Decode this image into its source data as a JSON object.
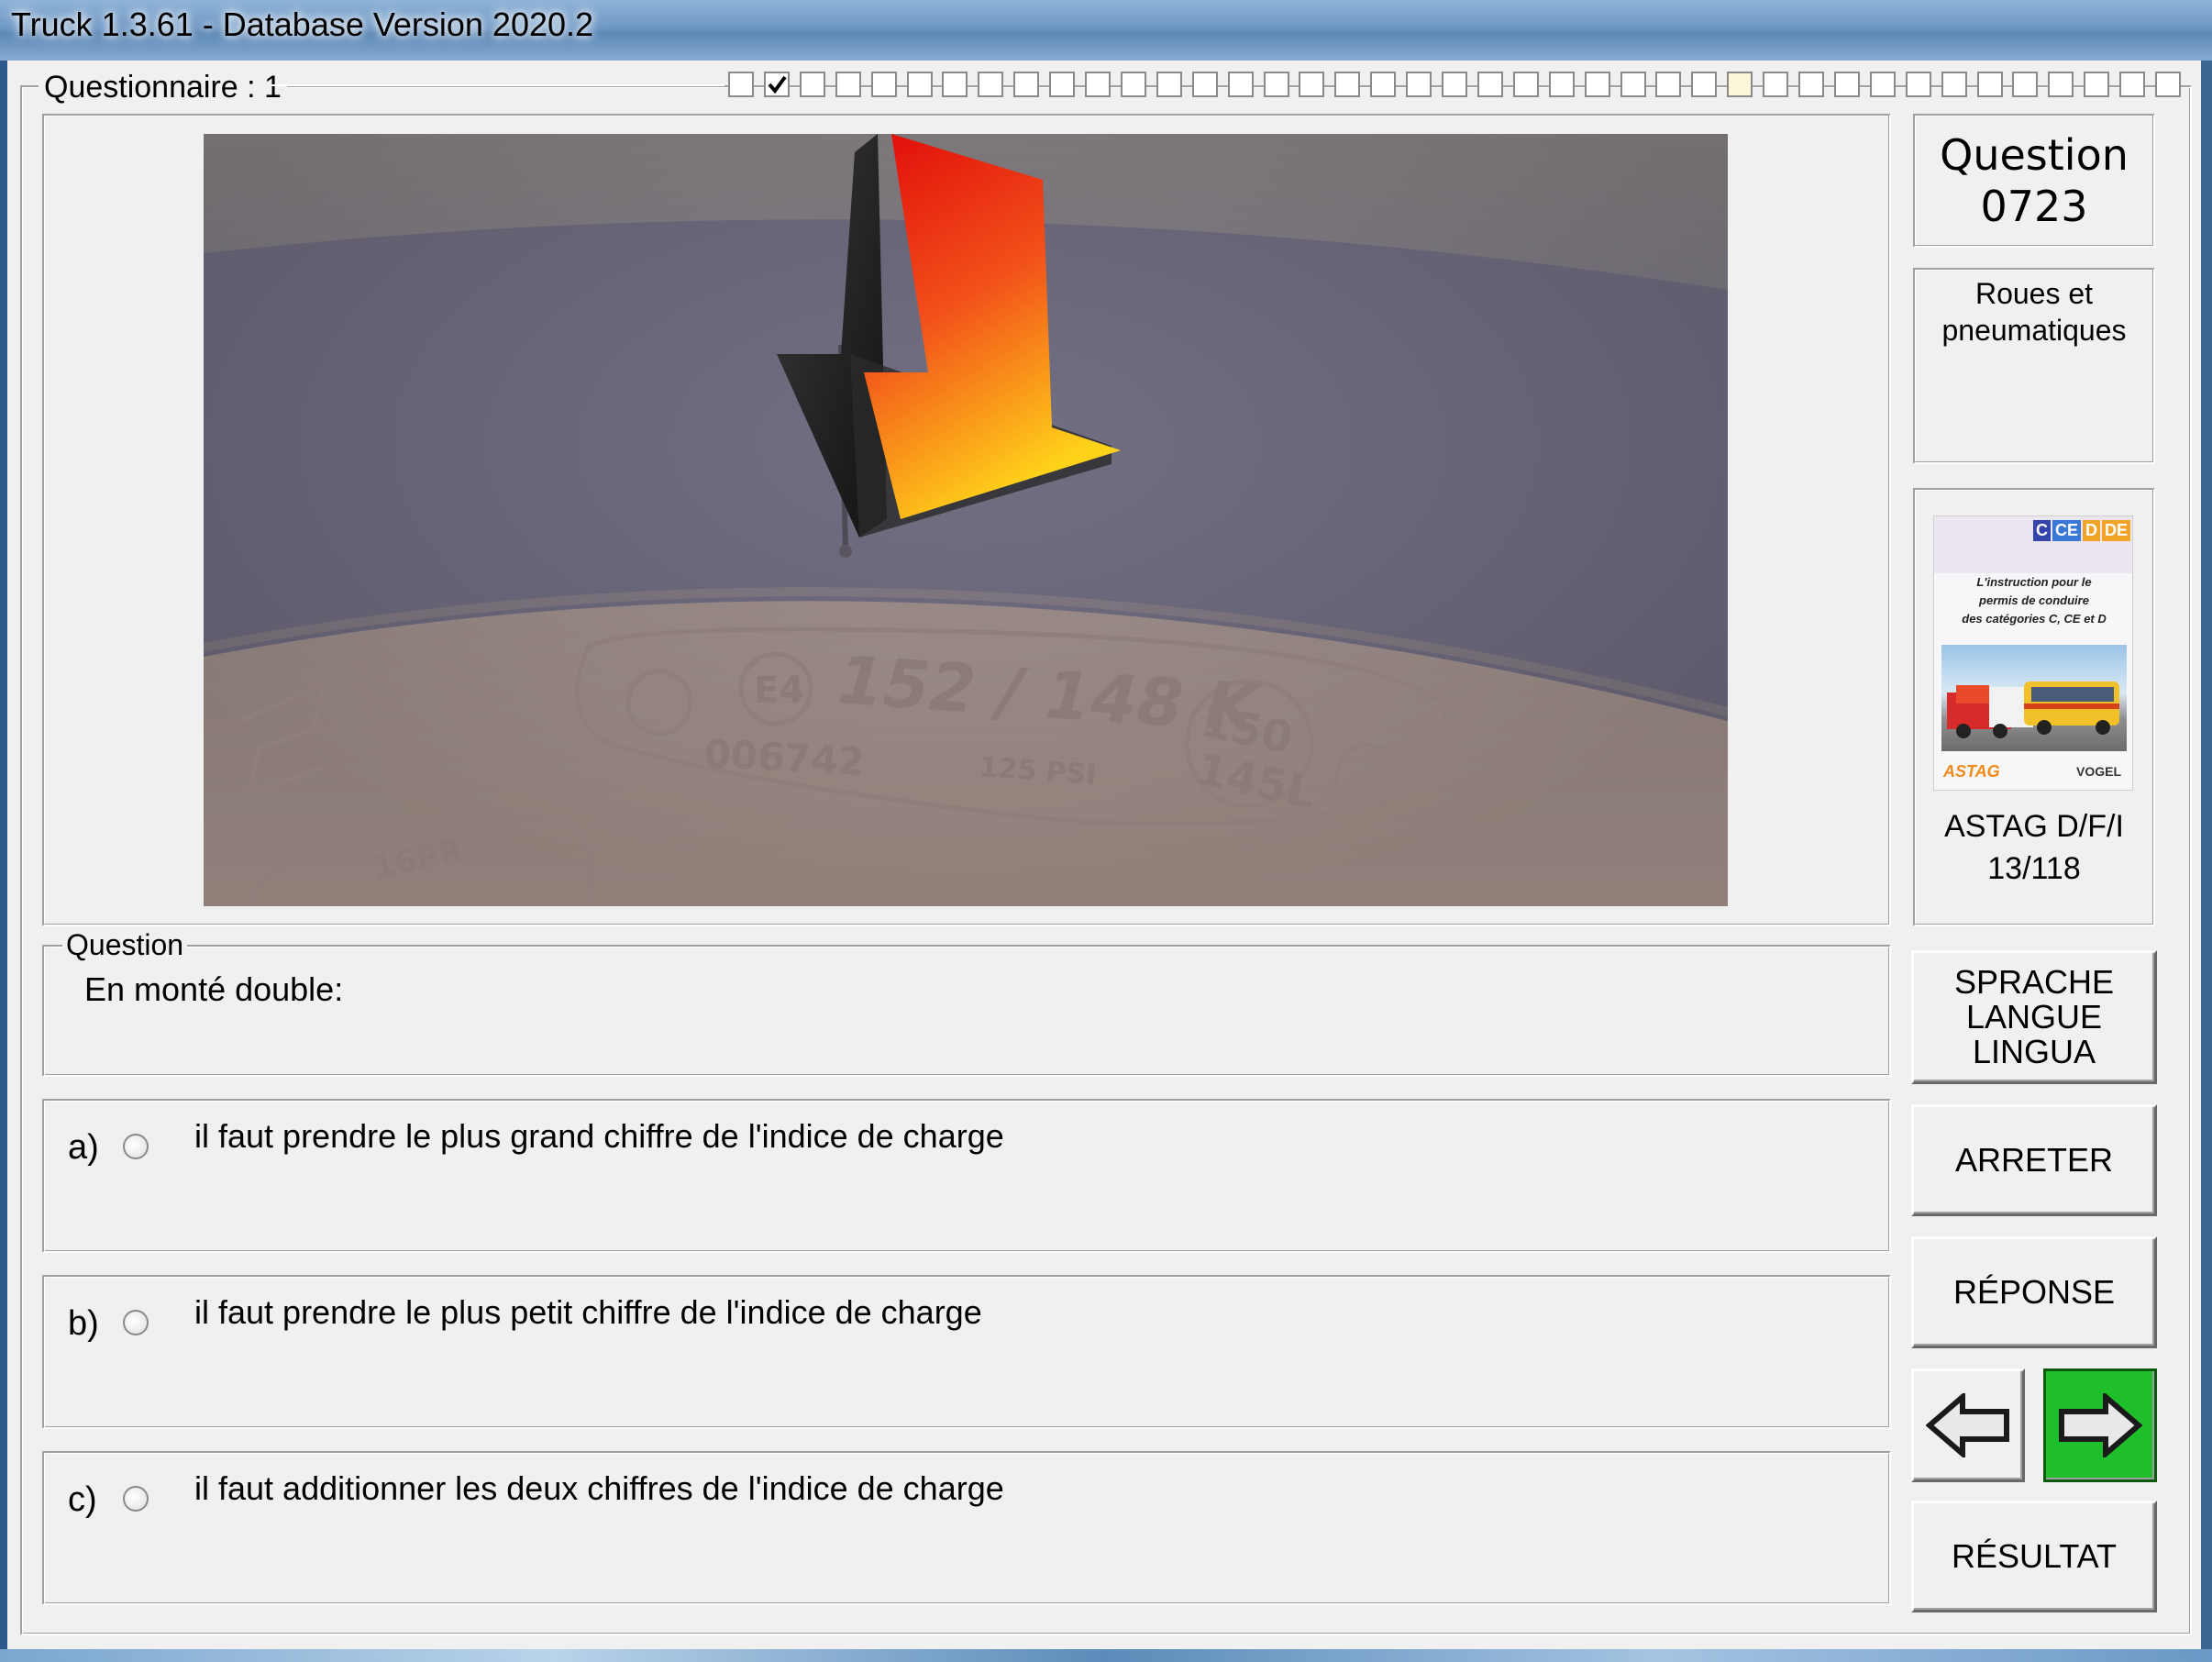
{
  "window": {
    "title": "Truck 1.3.61 - Database Version 2020.2"
  },
  "questionnaire": {
    "label": "Questionnaire : 1"
  },
  "question_box": {
    "heading": "Question",
    "number": "0723"
  },
  "category": {
    "text_line1": "Roues et",
    "text_line2": "pneumatiques"
  },
  "book": {
    "badges": [
      "C",
      "CE",
      "D",
      "DE"
    ],
    "subtitle_line1": "L'instruction pour le",
    "subtitle_line2": "permis de conduire",
    "subtitle_line3": "des catégories C, CE et D",
    "logo_left": "ASTAG",
    "logo_right": "VOGEL",
    "source": "ASTAG D/F/I",
    "page": "13/118"
  },
  "photo": {
    "tire_marking_load": "152 / 148 K",
    "tire_marking_code": "006742",
    "tire_marking_psi": "125 PSI",
    "tire_marking_alt_line1": "150",
    "tire_marking_alt_line2": "145L",
    "tire_marking_ply": "16PR",
    "tire_marking_approval": "E4"
  },
  "question": {
    "legend": "Question",
    "text": "En monté double:"
  },
  "answers": [
    {
      "letter": "a)",
      "text": "il faut prendre le plus grand chiffre de l'indice de charge"
    },
    {
      "letter": "b)",
      "text": "il faut prendre le plus petit chiffre de l'indice de charge"
    },
    {
      "letter": "c)",
      "text": "il faut additionner les deux chiffres de l'indice de charge"
    }
  ],
  "buttons": {
    "language_line1": "SPRACHE",
    "language_line2": "LANGUE",
    "language_line3": "LINGUA",
    "stop": "ARRETER",
    "answer": "RÉPONSE",
    "result": "RÉSULTAT"
  },
  "colors": {
    "next_button_bg": "#1ebf2a",
    "arrow_red": "#e81010",
    "arrow_yellow": "#ffd21a"
  }
}
